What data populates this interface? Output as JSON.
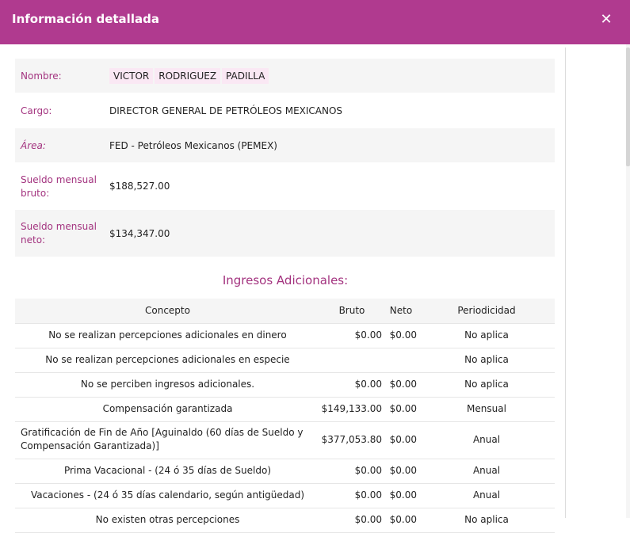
{
  "dialog": {
    "title": "Información detallada",
    "close_symbol": "✕"
  },
  "info": {
    "nombre_label": "Nombre:",
    "name_parts": [
      "VICTOR",
      "RODRIGUEZ",
      "PADILLA"
    ],
    "cargo_label": "Cargo:",
    "cargo_value": "DIRECTOR GENERAL DE PETRÓLEOS MEXICANOS",
    "area_label": "Área:",
    "area_value": "FED - Petróleos Mexicanos (PEMEX)",
    "sueldo_bruto_label": "Sueldo mensual bruto:",
    "sueldo_bruto_value": "$188,527.00",
    "sueldo_neto_label": "Sueldo mensual neto:",
    "sueldo_neto_value": "$134,347.00"
  },
  "ingresos": {
    "title": "Ingresos Adicionales:",
    "headers": [
      "Concepto",
      "Bruto",
      "Neto",
      "Periodicidad"
    ],
    "rows": [
      [
        "No se realizan percepciones adicionales en dinero",
        "$0.00",
        "$0.00",
        "No aplica"
      ],
      [
        "No se realizan percepciones adicionales en especie",
        "",
        "",
        "No aplica"
      ],
      [
        "No se perciben ingresos adicionales.",
        "$0.00",
        "$0.00",
        "No aplica"
      ],
      [
        "Compensación garantizada",
        "$149,133.00",
        "$0.00",
        "Mensual"
      ],
      [
        "Gratificación de Fin de Año [Aguinaldo (60 días de Sueldo y Compensación Garantizada)]",
        "$377,053.80",
        "$0.00",
        "Anual"
      ],
      [
        "Prima Vacacional - (24 ó 35 días de Sueldo)",
        "$0.00",
        "$0.00",
        "Anual"
      ],
      [
        "Vacaciones - (24 ó 35 días calendario, según antigüedad)",
        "$0.00",
        "$0.00",
        "Anual"
      ],
      [
        "No existen otras percepciones",
        "$0.00",
        "$0.00",
        "No aplica"
      ]
    ]
  },
  "colors": {
    "header": "#b03a8f",
    "accent": "#a3337f",
    "chip": "#fae8f4",
    "row_shade": "#f5f5f5"
  }
}
